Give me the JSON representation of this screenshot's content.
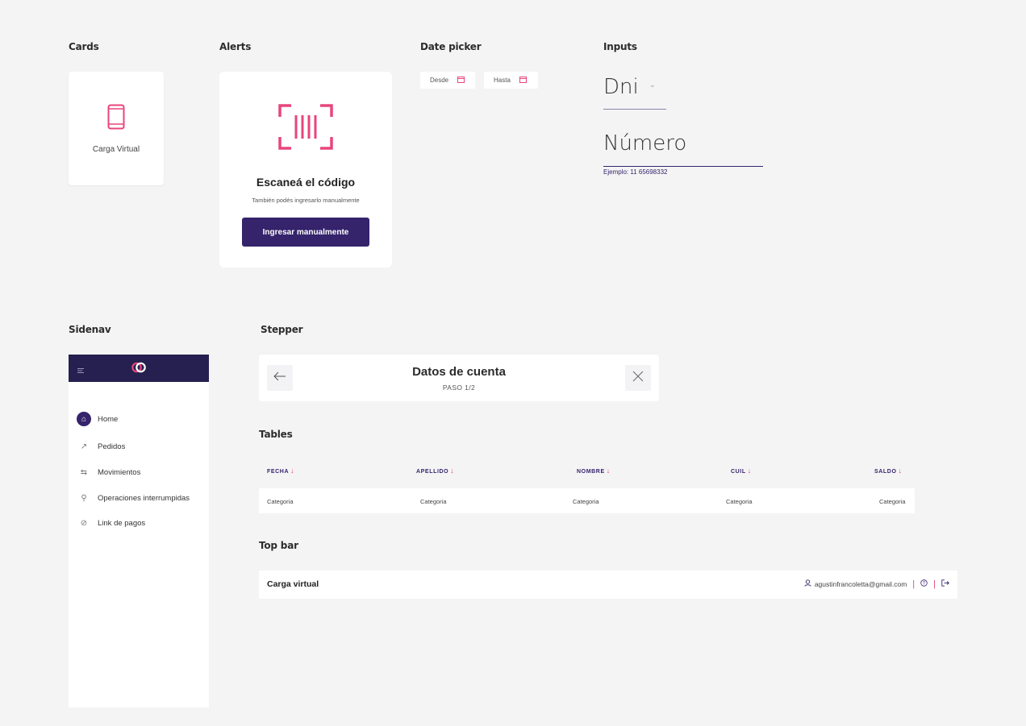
{
  "sections": {
    "cards": "Cards",
    "alerts": "Alerts",
    "date_picker": "Date picker",
    "inputs": "Inputs",
    "sidenav": "Sidenav",
    "stepper": "Stepper",
    "tables": "Tables",
    "top_bar": "Top bar"
  },
  "card": {
    "label": "Carga Virtual",
    "icon": "phone-icon"
  },
  "alert": {
    "icon": "barcode-scan-icon",
    "title": "Escaneá el código",
    "subtitle": "También podés ingresarlo manualmente",
    "button": "Ingresar manualmente"
  },
  "date_picker": {
    "from_label": "Desde",
    "to_label": "Hasta"
  },
  "inputs": {
    "doc_type": "Dni",
    "number_value": "Número",
    "number_help": "Ejemplo: 11 65698332"
  },
  "sidenav": {
    "items": [
      {
        "label": "Home",
        "icon": "home-icon",
        "active": true
      },
      {
        "label": "Pedidos",
        "icon": "trend-icon"
      },
      {
        "label": "Movimientos",
        "icon": "transfer-icon"
      },
      {
        "label": "Operaciones interrumpidas",
        "icon": "wrench-icon"
      },
      {
        "label": "Link de pagos",
        "icon": "link-icon"
      }
    ]
  },
  "stepper": {
    "title": "Datos de cuenta",
    "subtitle": "PASO 1/2"
  },
  "table": {
    "headers": [
      "FECHA",
      "APELLIDO",
      "NOMBRE",
      "CUIL",
      "SALDO"
    ],
    "rows": [
      [
        "Categoria",
        "Categoria",
        "Categoria",
        "Categoria",
        "Categoria"
      ]
    ]
  },
  "topbar": {
    "title": "Carga virtual",
    "user_email": "agustinfrancoletta@gmail.com"
  },
  "colors": {
    "primary": "#35236b",
    "accent": "#e8457d",
    "sidenav_header": "#25204f",
    "background": "#f4f4f5"
  }
}
